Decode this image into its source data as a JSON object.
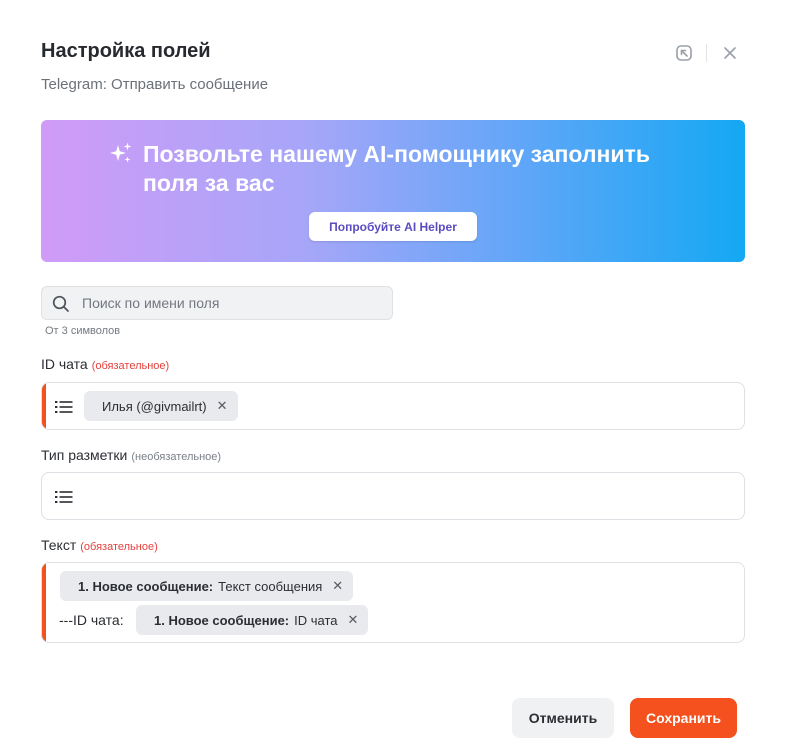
{
  "header": {
    "title": "Настройка полей",
    "subtitle": "Telegram: Отправить сообщение"
  },
  "icons": {
    "collapse": "collapse-arrow-icon",
    "close": "close-icon",
    "sparkle": "sparkle-icon",
    "search": "search-icon",
    "list": "list-icon"
  },
  "banner": {
    "text": "Позвольте нашему AI-помощнику заполнить поля за вас",
    "button_label": "Попробуйте AI Helper"
  },
  "search": {
    "placeholder": "Поиск по имени поля",
    "value": "",
    "hint": "От 3 символов"
  },
  "fields": {
    "chat_id": {
      "label": "ID чата",
      "badge": "(обязательное)",
      "chip": {
        "text": "Илья (@givmailrt)"
      }
    },
    "markup": {
      "label": "Тип разметки",
      "badge": "(необязательное)"
    },
    "text": {
      "label": "Текст",
      "badge": "(обязательное)",
      "chip1": {
        "prefix": "1. Новое сообщение:",
        "text": "Текст сообщения"
      },
      "static_text": "---ID чата:",
      "chip2": {
        "prefix": "1. Новое сообщение:",
        "text": "ID чата"
      }
    }
  },
  "footer": {
    "cancel_label": "Отменить",
    "save_label": "Сохранить"
  },
  "colors": {
    "accent": "#f4511e",
    "required_text": "#e5413d",
    "ai_button_text": "#5a4cbf",
    "banner_gradient": [
      "#d09bf7",
      "#a6a6f8",
      "#61a6f8",
      "#14a8f3"
    ]
  }
}
